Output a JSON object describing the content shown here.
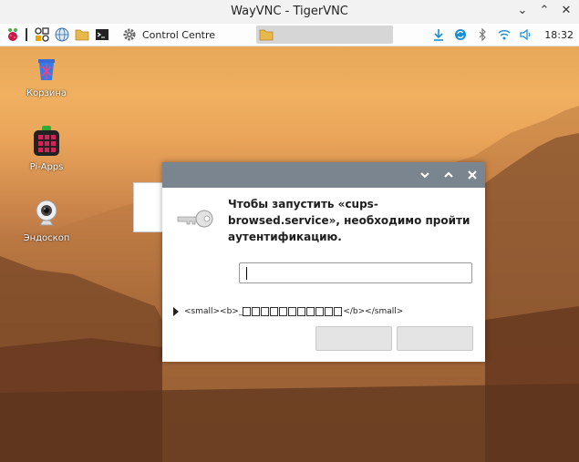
{
  "window": {
    "title": "WayVNC - TigerVNC"
  },
  "taskbar": {
    "windows": [
      {
        "label": "Control Centre",
        "icon": "gear-icon"
      },
      {
        "label": "",
        "icon": "folder-icon"
      }
    ],
    "clock": "18:32"
  },
  "desktop": {
    "icons": [
      {
        "label": "Корзина",
        "icon": "trash-icon"
      },
      {
        "label": "Pi-Apps",
        "icon": "pi-apps-icon"
      },
      {
        "label": "Эндоскоп",
        "icon": "webcam-icon"
      }
    ]
  },
  "dialog": {
    "message": "Чтобы запустить «cups-browsed.service», необходимо пройти аутентификацию.",
    "password_value": "",
    "details_prefix": "<small><b>_",
    "details_suffix": "</b></small>",
    "ok_label": "",
    "cancel_label": ""
  },
  "colors": {
    "dialog_header": "#7b858f",
    "accent_blue": "#1a8fd6"
  }
}
